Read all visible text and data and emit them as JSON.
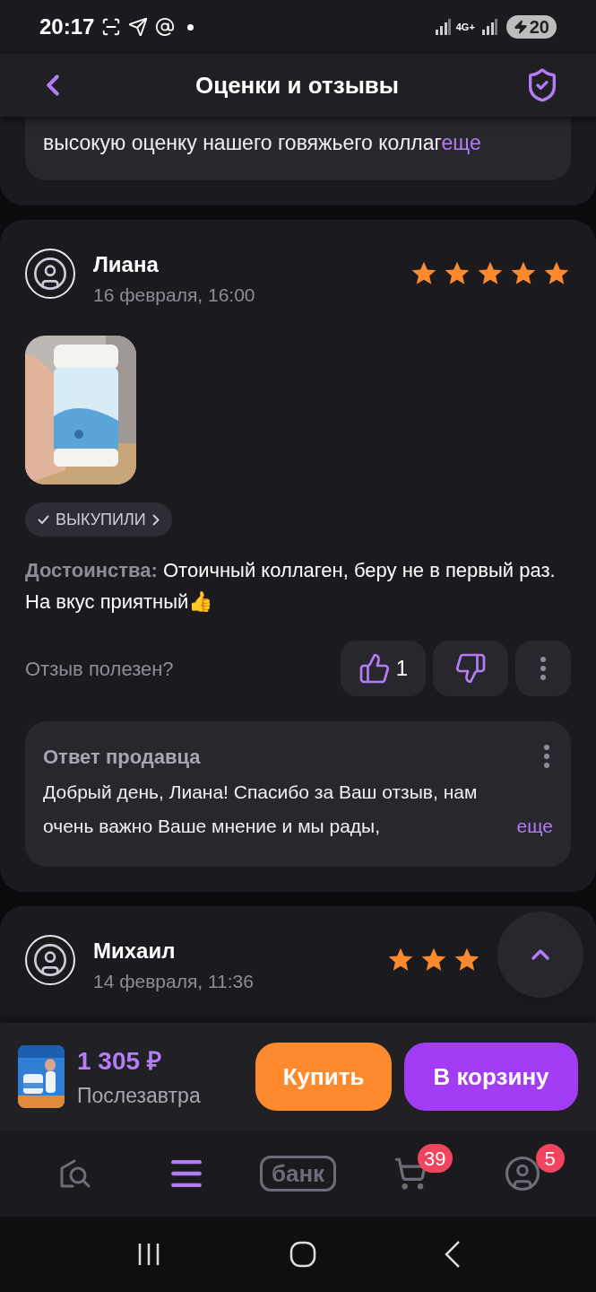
{
  "status_bar": {
    "time": "20:17",
    "network": "4G+",
    "battery": "20"
  },
  "header": {
    "title": "Оценки и отзывы"
  },
  "previous_reply": {
    "text": "высокую оценку нашего говяжьего коллаг",
    "more": "еще"
  },
  "reviews": [
    {
      "author": "Лиана",
      "date": "16 февраля, 16:00",
      "stars": 5,
      "photos": [
        {
          "kind": "picture"
        }
      ],
      "badge": "ВЫКУПИЛИ",
      "pros_label": "Достоинства:",
      "pros_text": "Отоичный коллаген, беру не в первый раз. На вкус приятный👍",
      "helpful_label": "Отзыв полезен?",
      "likes": "1",
      "seller_reply": {
        "title": "Ответ продавца",
        "text": "Добрый день, Лиана! Спасибо за Ваш отзыв, нам очень важно Ваше мнение и мы рады,",
        "more": "еще"
      }
    },
    {
      "author": "Михаил",
      "date": "14 февраля, 11:36",
      "stars": 3
    }
  ],
  "buy_bar": {
    "price": "1 305 ₽",
    "delivery": "Послезавтра",
    "buttons": [
      "Купить",
      "В корзину"
    ]
  },
  "tab_bar": [
    {
      "kind": "home-search",
      "selected": false
    },
    {
      "kind": "catalog",
      "selected": true
    },
    {
      "kind": "bank",
      "label": "банк",
      "selected": false
    },
    {
      "kind": "cart",
      "badge": "39",
      "selected": false
    },
    {
      "kind": "profile",
      "badge": "5",
      "selected": false
    }
  ]
}
